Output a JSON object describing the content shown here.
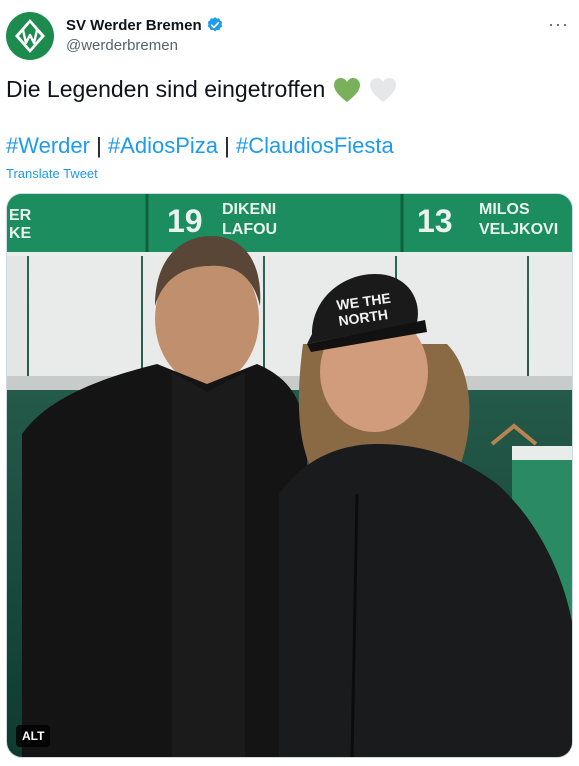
{
  "author": {
    "display_name": "SV Werder Bremen",
    "handle": "@werderbremen",
    "avatar_icon": "werder-w-logo-icon",
    "verified_icon": "verified-badge-icon",
    "brand_color": "#1d8a4e"
  },
  "tweet": {
    "text": "Die Legenden sind eingetroffen",
    "emojis": [
      "green-heart-icon",
      "white-heart-icon"
    ],
    "hashtags": [
      "#Werder",
      "#AdiosPiza",
      "#ClaudiosFiesta"
    ],
    "separator": "|",
    "translate_label": "Translate Tweet",
    "link_color": "#1d9bf0"
  },
  "media": {
    "alt_label": "ALT",
    "banner_left_text": "ER\nKE",
    "banner_mid_number": "19",
    "banner_mid_name": "DIKENI\nLAFOU",
    "banner_right_number": "13",
    "banner_right_name": "MILOS\nVELJKOVIĆ",
    "cap_text": "WE THE\nNORTH"
  },
  "menu": {
    "more_label": "···"
  }
}
